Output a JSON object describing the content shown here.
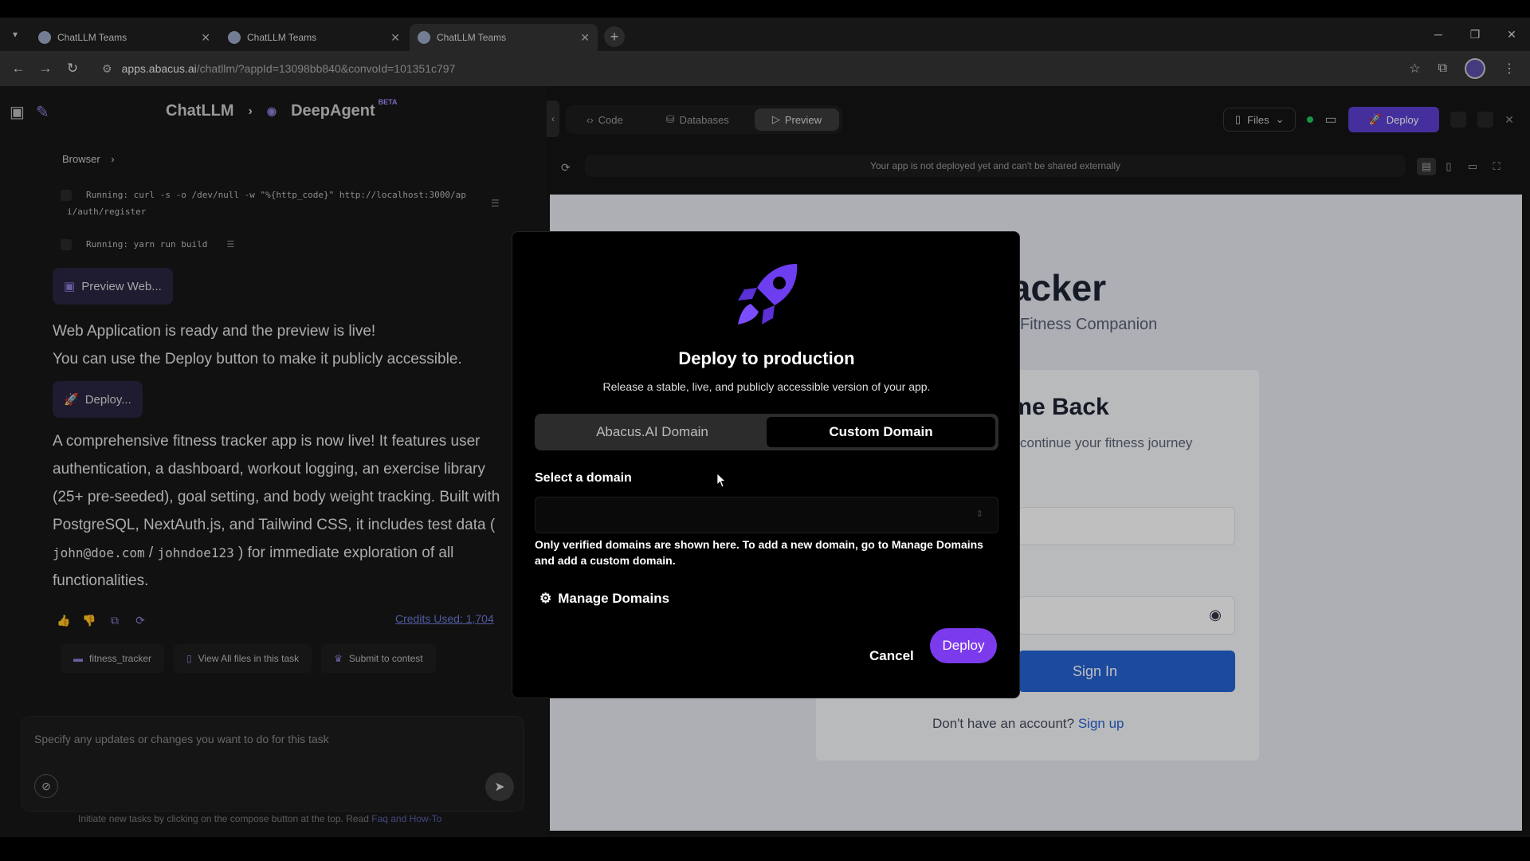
{
  "browser": {
    "tabs": [
      {
        "title": "ChatLLM Teams",
        "active": false
      },
      {
        "title": "ChatLLM Teams",
        "active": false
      },
      {
        "title": "ChatLLM Teams",
        "active": true
      }
    ],
    "url_host": "apps.abacus.ai",
    "url_path": "/chatllm/?appId=13098bb840&convoId=101351c797"
  },
  "left": {
    "app_name": "ChatLLM",
    "agent_name": "DeepAgent",
    "beta": "BETA",
    "browser_label": "Browser",
    "run1_line1": "Running: curl -s -o /dev/null -w \"%{http_code}\" http://localhost:3000/ap",
    "run1_line2": "i/auth/register",
    "run2": "Running: yarn run build",
    "preview_pill": "Preview Web...",
    "msg1_line1": "Web Application is ready and the preview is live!",
    "msg1_line2": "You can use the Deploy button to make it publicly accessible.",
    "deploy_pill": "Deploy...",
    "summary_a": "A comprehensive fitness tracker app is now live! It features user authentication, a dashboard, workout logging, an exercise library (25+ pre-seeded), goal setting, and body weight tracking. Built with PostgreSQL, NextAuth.js, and Tailwind CSS, it includes test data ( ",
    "code1": "john@doe.com",
    "slash": " / ",
    "code2": "johndoe123",
    "summary_b": " ) for immediate exploration of all functionalities.",
    "credits": "Credits Used: 1,704",
    "chips": [
      "fitness_tracker",
      "View All files in this task",
      "Submit to contest"
    ],
    "composer_placeholder": "Specify any updates or changes you want to do for this task",
    "hint_text": "Initiate new tasks by clicking on the compose button at the top. Read",
    "hint_link": "Faq and How-To"
  },
  "right": {
    "seg_code": "Code",
    "seg_db": "Databases",
    "seg_preview": "Preview",
    "files": "Files",
    "deploy": "Deploy",
    "notice": "Your app is not deployed yet and can't be shared externally",
    "preview": {
      "title": "racker",
      "subtitle": "Fitness Companion",
      "card_title": "ome Back",
      "card_sub": "continue your fitness journey",
      "signin": "Sign In",
      "no_account": "Don't have an account?",
      "signup": "Sign up"
    }
  },
  "modal": {
    "title": "Deploy to production",
    "subtitle": "Release a stable, live, and publicly accessible version of your app.",
    "tab_abacus": "Abacus.AI Domain",
    "tab_custom": "Custom Domain",
    "select_label": "Select a domain",
    "help": "Only verified domains are shown here. To add a new domain, go to Manage Domains and add a custom domain.",
    "manage": "Manage Domains",
    "cancel": "Cancel",
    "deploy": "Deploy"
  },
  "colors": {
    "accent": "#7c3aed",
    "deploy_bar": "#5b3fd1",
    "signin": "#2563d4"
  }
}
